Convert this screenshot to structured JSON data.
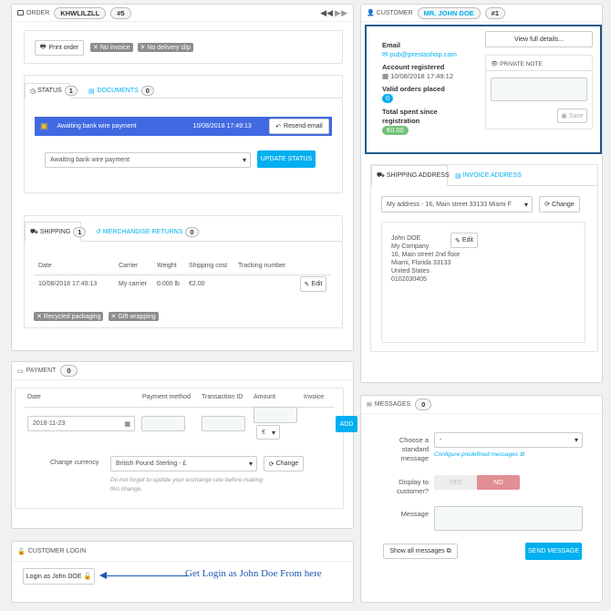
{
  "order": {
    "label": "ORDER",
    "reference": "KHWLILZLL",
    "id": "#5",
    "print_order": "Print order",
    "no_invoice": "No invoice",
    "no_delivery_slip": "No delivery slip",
    "status_tab": "STATUS",
    "status_count": "1",
    "documents_tab": "DOCUMENTS",
    "documents_count": "0",
    "status_row": {
      "name": "Awaiting bank wire payment",
      "date": "10/08/2018 17:49:13",
      "resend": "Resend email"
    },
    "status_select": "Awaiting bank wire payment",
    "update_status": "UPDATE STATUS",
    "status_color": "#4169e1"
  },
  "shipping": {
    "tab": "SHIPPING",
    "count": "1",
    "returns_tab": "MERCHANDISE RETURNS",
    "returns_count": "0",
    "headers": {
      "date": "Date",
      "carrier": "Carrier",
      "weight": "Weight",
      "cost": "Shipping cost",
      "tracking": "Tracking number"
    },
    "row": {
      "date": "10/08/2018 17:49:13",
      "carrier": "My carrier",
      "weight": "0.000 lb",
      "cost": "€2.00",
      "edit": "Edit"
    },
    "recycled": "Recycled packaging",
    "gift": "Gift wrapping"
  },
  "payment": {
    "title": "PAYMENT",
    "count": "0",
    "headers": {
      "date": "Date",
      "method": "Payment method",
      "transaction": "Transaction ID",
      "amount": "Amount",
      "invoice": "Invoice"
    },
    "date_value": "2018-11-23",
    "currency_symbol": "€",
    "add": "ADD",
    "change_currency_label": "Change currency",
    "currency_select": "British Pound Sterling - £",
    "change": "Change",
    "note": "Do not forget to update your exchange rate before making this change."
  },
  "customer_login": {
    "title": "CUSTOMER LOGIN",
    "button": "Login as John DOE",
    "annotation": "Get Login as John Doe From here"
  },
  "customer": {
    "label": "CUSTOMER",
    "name": "MR. JOHN DOE",
    "id": "#1",
    "email_label": "Email",
    "email": "pub@prestashop.com",
    "registered_label": "Account registered",
    "registered": "10/08/2018 17:49:12",
    "valid_orders_label": "Valid orders placed",
    "valid_orders": "0",
    "spent_label_1": "Total spent since",
    "spent_label_2": "registration",
    "spent": "€0.00",
    "view_details": "View full details...",
    "private_note": "PRIVATE NOTE",
    "save": "Save"
  },
  "address": {
    "shipping_tab": "SHIPPING ADDRESS",
    "invoice_tab": "INVOICE ADDRESS",
    "select": "My address - 16, Main street 33133 Miami F",
    "change": "Change",
    "lines": [
      "John DOE",
      "My Company",
      "16, Main street 2nd floor",
      "Miami, Florida 33133",
      "United States",
      "0102030405"
    ],
    "edit": "Edit"
  },
  "messages": {
    "title": "MESSAGES",
    "count": "0",
    "choose_label_1": "Choose a",
    "choose_label_2": "standard",
    "choose_label_3": "message",
    "choose_select": "-",
    "configure_link": "Configure predefined messages",
    "display_label_1": "Display to",
    "display_label_2": "customer?",
    "yes": "YES",
    "no": "NO",
    "message_label": "Message",
    "show_all": "Show all messages",
    "send": "SEND MESSAGE"
  }
}
